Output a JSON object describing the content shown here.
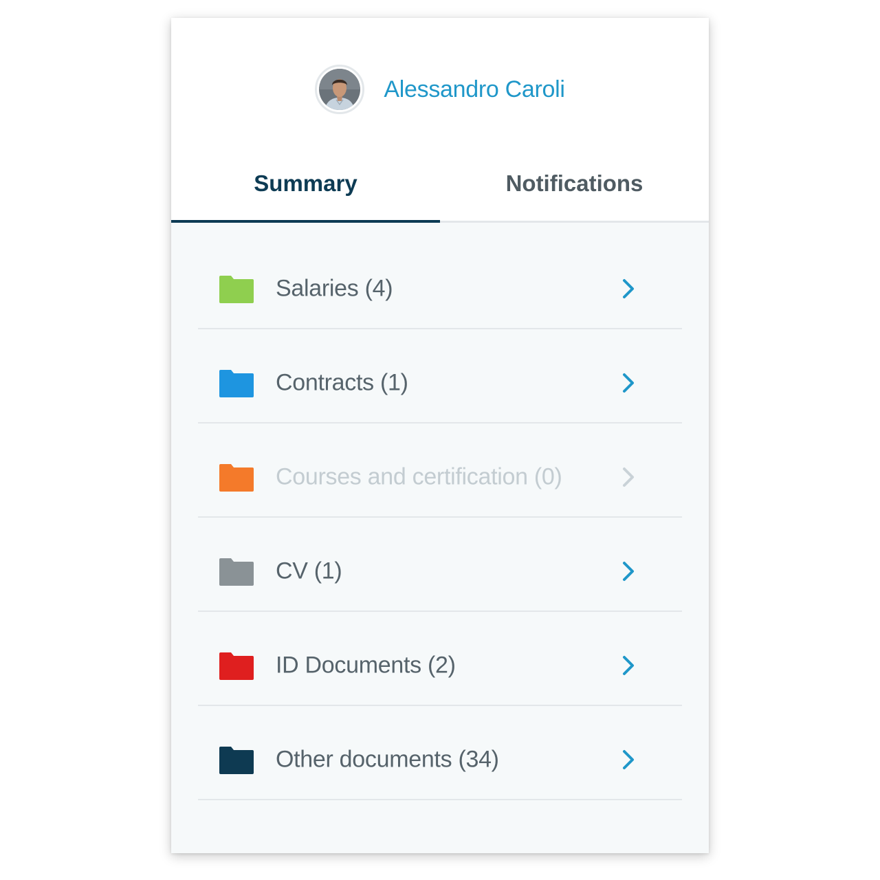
{
  "user": {
    "name": "Alessandro Caroli"
  },
  "tabs": [
    {
      "label": "Summary",
      "active": true
    },
    {
      "label": "Notifications",
      "active": false
    }
  ],
  "colors": {
    "accent": "#1f97c9",
    "tab_active": "#0d3b54",
    "chevron": "#1f97c9",
    "chevron_disabled": "#c9d2d7"
  },
  "folders": [
    {
      "label": "Salaries (4)",
      "color": "#8fcf4f",
      "icon": "folder-icon",
      "disabled": false
    },
    {
      "label": "Contracts (1)",
      "color": "#1e95e0",
      "icon": "folder-icon",
      "disabled": false
    },
    {
      "label": "Courses and certification (0)",
      "color": "#f47a2a",
      "icon": "folder-icon",
      "disabled": true
    },
    {
      "label": "CV (1)",
      "color": "#8a9296",
      "icon": "folder-icon",
      "disabled": false
    },
    {
      "label": "ID Documents (2)",
      "color": "#df1f1f",
      "icon": "folder-icon",
      "disabled": false
    },
    {
      "label": "Other documents (34)",
      "color": "#0e3a52",
      "icon": "folder-icon",
      "disabled": false
    }
  ]
}
